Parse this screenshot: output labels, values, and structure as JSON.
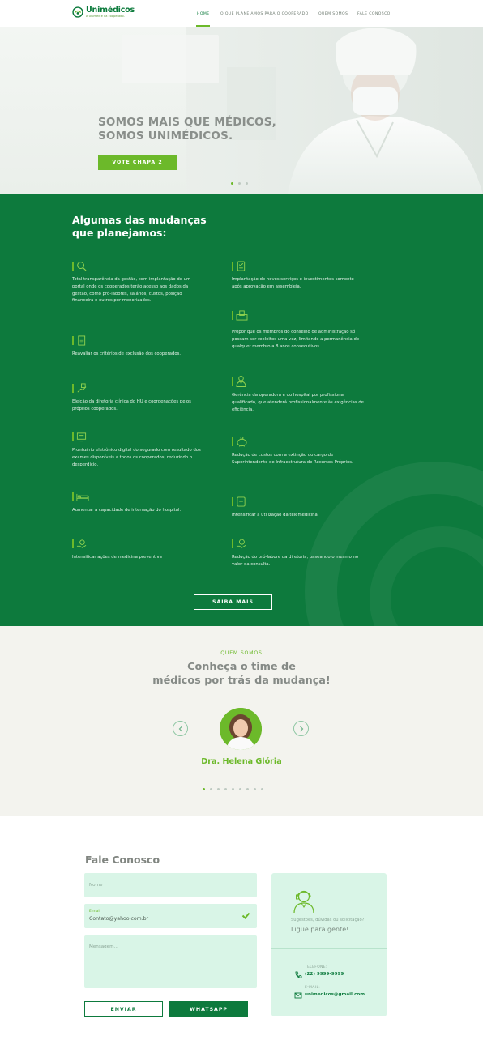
{
  "brand": {
    "name": "Unimédicos",
    "tagline": "A Unimed é da cooperado."
  },
  "nav": {
    "items": [
      "HOME",
      "O QUE PLANEJAMOS PARA O COOPERADO",
      "QUEM SOMOS",
      "FALE CONOSCO"
    ],
    "active": "HOME"
  },
  "hero": {
    "title_line1": "SOMOS MAIS QUE MÉDICOS,",
    "title_line2": "SOMOS UNIMÉDICOS.",
    "cta": "VOTE CHAPA 2",
    "slides": 3,
    "active_slide": 1
  },
  "changes": {
    "title_line1": "Algumas das mudanças",
    "title_line2": "que planejamos:",
    "left": [
      {
        "icon": "search-icon",
        "text": "Total transparência da gestão, com implantação de um portal onde os cooperados terão acesso aos dados da gestão, como pró-labores, salários, custos, posição financeira e outros por-menorizados."
      },
      {
        "icon": "document-icon",
        "text": "Reavaliar os critérios de exclusão dos cooperados."
      },
      {
        "icon": "vote-hand-icon",
        "text": "Eleição da diretoria clínica do HU e coordenações pelos próprios cooperados."
      },
      {
        "icon": "computer-icon",
        "text": "Prontuário eletrônico digital do segurado com resultado dos exames disponíveis a todos os cooperados, reduzindo o desperdício."
      },
      {
        "icon": "hospital-bed-icon",
        "text": "Aumentar a capacidade de internação do hospital."
      },
      {
        "icon": "hand-care-icon",
        "text": "Intensificar ações de medicina preventiva"
      }
    ],
    "right": [
      {
        "icon": "checklist-icon",
        "text": "Implantação de novos serviços e investimentos somente após aprovação em assembleia."
      },
      {
        "icon": "ballot-box-icon",
        "text": "Propor que os membros do conselho de administração só possam ser reeleitos uma vez, limitando a permanência de qualquer membro a 8 anos consecutivos."
      },
      {
        "icon": "professional-icon",
        "text": "Gerência da operadora e do hospital por profissional qualificado, que atenderá profissionalmente às exigências de eficiência."
      },
      {
        "icon": "piggy-bank-icon",
        "text": "Redução de custos com a extinção do cargo de Superintendente de Infraestrutura de Recursos Próprios."
      },
      {
        "icon": "telemedicine-icon",
        "text": "Intensificar a utilização da telemedicina."
      },
      {
        "icon": "money-hand-icon",
        "text": "Redução do pró-labore da diretoria, baseando o mesmo no valor da consulta."
      }
    ],
    "cta": "SAIBA MAIS"
  },
  "team": {
    "kicker": "QUEM SOMOS",
    "title_line1": "Conheça o time de",
    "title_line2": "médicos por trás da mudança!",
    "member": "Dra. Helena Glória",
    "dots": 9,
    "active_dot": 1
  },
  "contact": {
    "title": "Fale Conosco",
    "name_placeholder": "Nome",
    "email_label": "E-mail",
    "email_value": "Contato@yahoo.com.br",
    "message_placeholder": "Mensagem...",
    "send": "ENVIAR",
    "whatsapp": "WHATSAPP",
    "card_sub": "Sugestões, dúvidas ou solicitação?",
    "card_main": "Ligue para gente!",
    "phone_label": "TELEFONE:",
    "phone": "(22) 9999-9999",
    "mail_label": "E-MAIL:",
    "mail": "unimedicos@gmail.com"
  },
  "colors": {
    "primary": "#0d7a3d",
    "accent": "#6cb92a",
    "mint": "#d9f5e7",
    "grey_bg": "#f3f3ee"
  }
}
